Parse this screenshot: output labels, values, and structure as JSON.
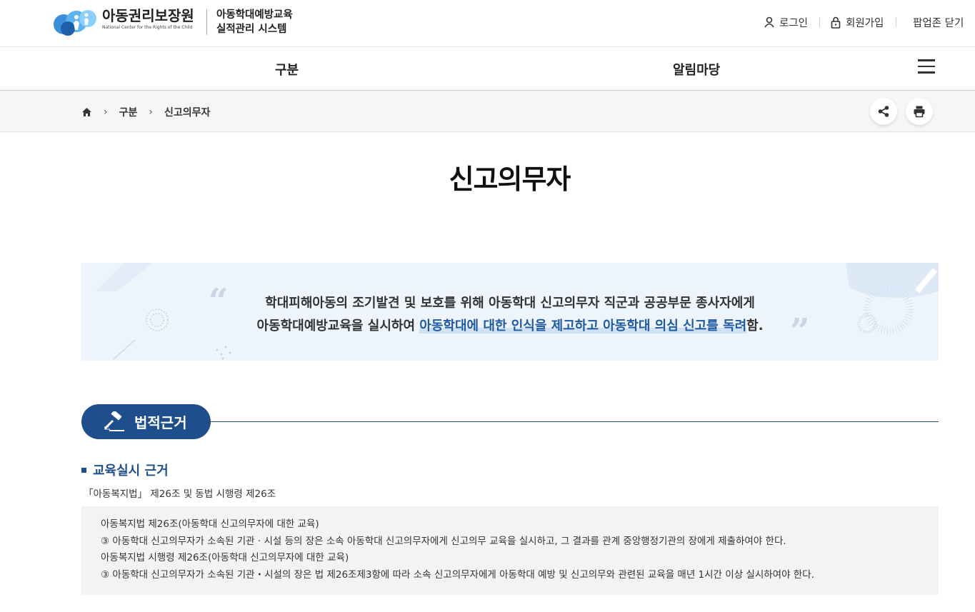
{
  "header": {
    "logo_text": "아동권리보장원",
    "logo_subtext": "National Center for the Rights of the Child",
    "system_title_line1": "아동학대예방교육",
    "system_title_line2": "실적관리 시스템",
    "login_label": "로그인",
    "join_label": "회원가입",
    "popup_close_label": "팝업존 닫기"
  },
  "gnb": {
    "items": [
      {
        "label": "구분"
      },
      {
        "label": "알림마당"
      }
    ]
  },
  "breadcrumb": {
    "items": [
      "구분",
      "신고의무자"
    ]
  },
  "page": {
    "title": "신고의무자"
  },
  "quote": {
    "line1": "학대피해아동의 조기발견 및 보호를 위해 아동학대 신고의무자 직군과 공공부문 종사자에게",
    "line2_plain": "아동학대예방교육을 실시하여 ",
    "line2_highlight": "아동학대에 대한 인식을 제고하고 아동학대 의심 신고를 독려",
    "line2_end": "함."
  },
  "section": {
    "title": "법적근거",
    "subtitle": "교육실시 근거",
    "legal_reference": "「아동복지법」 제26조 및 동법 시행령 제26조",
    "law_lines": [
      "아동복지법 제26조(아동학대 신고의무자에 대한 교육)",
      "③ 아동학대 신고의무자가 소속된 기관 · 시설 등의 장은 소속 아동학대 신고의무자에게 신고의무 교육을 실시하고, 그 결과를 관계 중앙행정기관의 장에게 제출하여야 한다.",
      "아동복지법 시행령 제26조(아동학대 신고의무자에 대한 교육)",
      "③ 아동학대 신고의무자가 소속된 기관・시설의 장은 법 제26조제3항에 따라 소속 신고의무자에게 아동학대 예방 및 신고의무와 관련된 교육을 매년 1시간 이상 실시하여야 한다."
    ]
  },
  "colors": {
    "primary": "#1f4e8c",
    "highlight_text": "#1e5aa0",
    "quote_bg": "#eef4fb",
    "law_bg": "#f3f3f3"
  }
}
